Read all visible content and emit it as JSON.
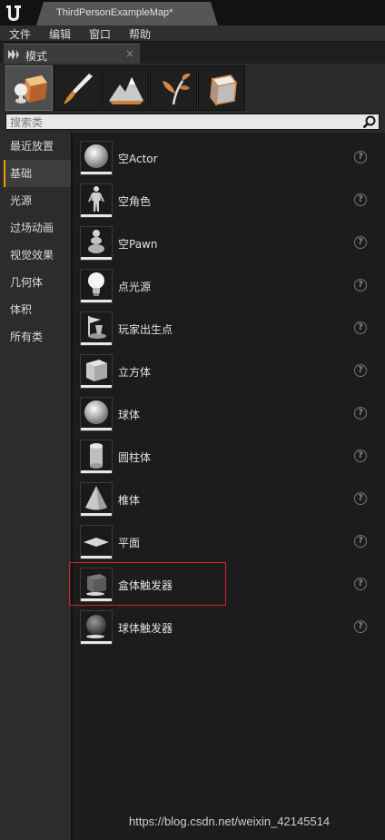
{
  "document_tab": {
    "title": "ThirdPersonExampleMap*"
  },
  "menu": [
    "文件",
    "编辑",
    "窗口",
    "帮助"
  ],
  "panel_tab": {
    "label": "模式",
    "close": "×"
  },
  "modes": [
    {
      "name": "place-mode",
      "icon": "place-icon",
      "active": true
    },
    {
      "name": "paint-mode",
      "icon": "paint-brush-icon",
      "active": false
    },
    {
      "name": "landscape-mode",
      "icon": "landscape-icon",
      "active": false
    },
    {
      "name": "foliage-mode",
      "icon": "foliage-icon",
      "active": false
    },
    {
      "name": "geometry-mode",
      "icon": "geometry-icon",
      "active": false
    }
  ],
  "search": {
    "placeholder": "搜索类",
    "value": ""
  },
  "categories": [
    {
      "label": "最近放置",
      "active": false
    },
    {
      "label": "基础",
      "active": true
    },
    {
      "label": "光源",
      "active": false
    },
    {
      "label": "过场动画",
      "active": false
    },
    {
      "label": "视觉效果",
      "active": false
    },
    {
      "label": "几何体",
      "active": false
    },
    {
      "label": "体积",
      "active": false
    },
    {
      "label": "所有类",
      "active": false
    }
  ],
  "items": [
    {
      "label": "空Actor",
      "icon": "sphere-icon"
    },
    {
      "label": "空角色",
      "icon": "character-icon"
    },
    {
      "label": "空Pawn",
      "icon": "pawn-icon"
    },
    {
      "label": "点光源",
      "icon": "lightbulb-icon"
    },
    {
      "label": "玩家出生点",
      "icon": "player-start-icon"
    },
    {
      "label": "立方体",
      "icon": "cube-icon"
    },
    {
      "label": "球体",
      "icon": "sphere-icon"
    },
    {
      "label": "圆柱体",
      "icon": "cylinder-icon"
    },
    {
      "label": "椎体",
      "icon": "cone-icon"
    },
    {
      "label": "平面",
      "icon": "plane-icon"
    },
    {
      "label": "盒体触发器",
      "icon": "box-trigger-icon"
    },
    {
      "label": "球体触发器",
      "icon": "sphere-trigger-icon"
    }
  ],
  "help_glyph": "?",
  "watermark": "https://blog.csdn.net/weixin_42145514",
  "colors": {
    "active_accent": "#e8a000",
    "highlight": "#d8232a"
  }
}
